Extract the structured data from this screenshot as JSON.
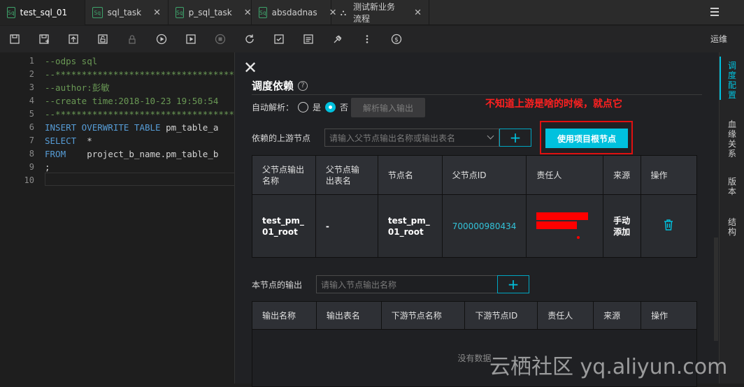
{
  "tabs": [
    {
      "badge": "Sq",
      "label": "test_sql_01",
      "active": true,
      "state": "dot"
    },
    {
      "badge": "Sq",
      "label": "sql_task",
      "state": "close"
    },
    {
      "badge": "Sq",
      "label": "p_sql_task",
      "state": "close"
    },
    {
      "badge": "Sq",
      "label": "absdadnas",
      "state": "close"
    },
    {
      "badge": "",
      "label": "测试新业务流程",
      "state": "close"
    }
  ],
  "close_glyph": "✕",
  "toolbar": {
    "icons": [
      "save-icon",
      "save-as-icon",
      "submit-icon",
      "steal-lock-icon",
      "lock-icon",
      "run-icon",
      "run-with-params-icon",
      "stop-icon",
      "reload-icon",
      "format-icon",
      "log-icon",
      "build-icon",
      "more-icon",
      "cost-icon"
    ],
    "ops_label": "运维"
  },
  "editor": {
    "line_numbers": [
      "1",
      "2",
      "3",
      "4",
      "5",
      "6",
      "7",
      "8",
      "9",
      "10"
    ],
    "lines": [
      [
        {
          "t": "--odps sql",
          "c": "cmt"
        }
      ],
      [
        {
          "t": "--*******************************************",
          "c": "cmt"
        }
      ],
      [
        {
          "t": "--author:彭敏",
          "c": "cmt"
        }
      ],
      [
        {
          "t": "--create time:2018-10-23 19:50:54",
          "c": "cmt"
        }
      ],
      [
        {
          "t": "--*******************************************",
          "c": "cmt"
        }
      ],
      [
        {
          "t": "INSERT OVERWRITE TABLE ",
          "c": "kw"
        },
        {
          "t": "pm_table_a",
          "c": "tx"
        }
      ],
      [
        {
          "t": "SELECT",
          "c": "kw"
        },
        {
          "t": "  *",
          "c": "tx"
        }
      ],
      [
        {
          "t": "FROM",
          "c": "kw"
        },
        {
          "t": "    project_b_name.pm_table_b",
          "c": "tx"
        }
      ],
      [
        {
          "t": ";",
          "c": "tx"
        }
      ],
      [
        {
          "t": "",
          "c": "tx"
        }
      ]
    ]
  },
  "panel": {
    "close": "✕",
    "title": "调度依赖",
    "help": "?",
    "auto_parse_label": "自动解析：",
    "radio_yes": "是",
    "radio_no": "否",
    "parse_button": "解析输入输出",
    "annotation": "不知道上游是啥的时候，就点它",
    "upstream_label": "依赖的上游节点",
    "upstream_placeholder": "请输入父节点输出名称或输出表名",
    "use_root_button": "使用项目根节点",
    "plus": "+",
    "upstream_table": {
      "headers": [
        "父节点输出名称",
        "父节点输出表名",
        "节点名",
        "父节点ID",
        "责任人",
        "来源",
        "操作"
      ],
      "rows": [
        {
          "output_name": "test_pm_01_root",
          "output_table": "-",
          "node_name": "test_pm_01_root",
          "node_id": "700000980434",
          "owner": "",
          "source": "手动添加"
        }
      ]
    },
    "output_label": "本节点的输出",
    "output_placeholder": "请输入节点输出名称",
    "output_table": {
      "headers": [
        "输出名称",
        "输出表名",
        "下游节点名称",
        "下游节点ID",
        "责任人",
        "来源",
        "操作"
      ],
      "empty": "没有数据"
    }
  },
  "rightbar": {
    "items": [
      "调度配置",
      "血缘关系",
      "版本",
      "结构"
    ]
  },
  "watermark": "云栖社区 yq.aliyun.com",
  "colors": {
    "accent": "#00c1de",
    "annotation": "#ff2020",
    "comment": "#6a9955",
    "keyword": "#569cd6"
  }
}
